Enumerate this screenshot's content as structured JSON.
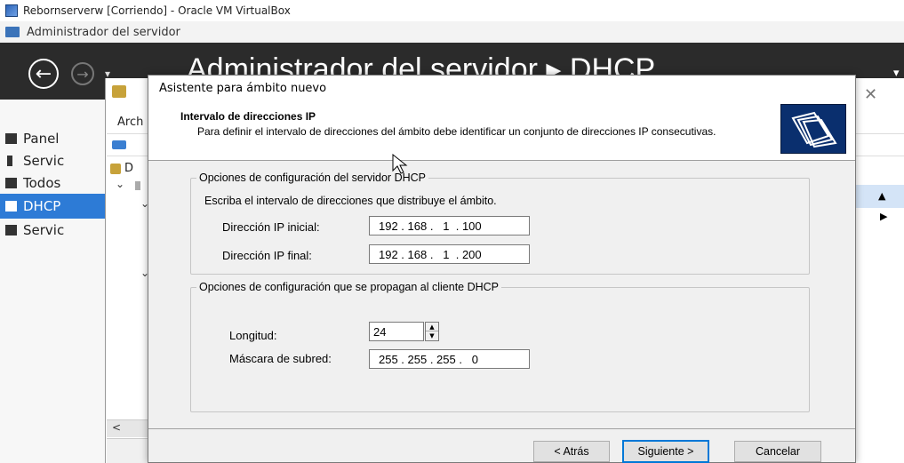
{
  "vbox": {
    "title": "Rebornserverw [Corriendo] - Oracle VM VirtualBox"
  },
  "server_manager": {
    "title": "Administrador del servidor",
    "header_breadcrumb": "Administrador del servidor ▸ DHCP"
  },
  "left_nav": {
    "items": [
      {
        "label": "Panel"
      },
      {
        "label": "Servic"
      },
      {
        "label": "Todos"
      },
      {
        "label": "DHCP"
      },
      {
        "label": "Servic"
      }
    ]
  },
  "mmc": {
    "menu_first": "Arch",
    "tree_first": "D"
  },
  "wizard": {
    "title": "Asistente para ámbito nuevo",
    "heading": "Intervalo de direcciones IP",
    "description": "Para definir el intervalo de direcciones del ámbito debe identificar un conjunto de direcciones IP consecutivas.",
    "group1": {
      "legend": "Opciones de configuración del servidor DHCP",
      "instruction": "Escriba el intervalo de direcciones que distribuye el ámbito.",
      "start_label": "Dirección IP inicial:",
      "start_value": "192 . 168 .   1  . 100",
      "end_label": "Dirección IP final:",
      "end_value": "192 . 168 .   1  . 200"
    },
    "group2": {
      "legend": "Opciones de configuración que se propagan al cliente DHCP",
      "length_label": "Longitud:",
      "length_value": "24",
      "mask_label": "Máscara de subred:",
      "mask_value": "255 . 255 . 255 .   0"
    },
    "buttons": {
      "back": "< Atrás",
      "next": "Siguiente >",
      "cancel": "Cancelar"
    }
  }
}
